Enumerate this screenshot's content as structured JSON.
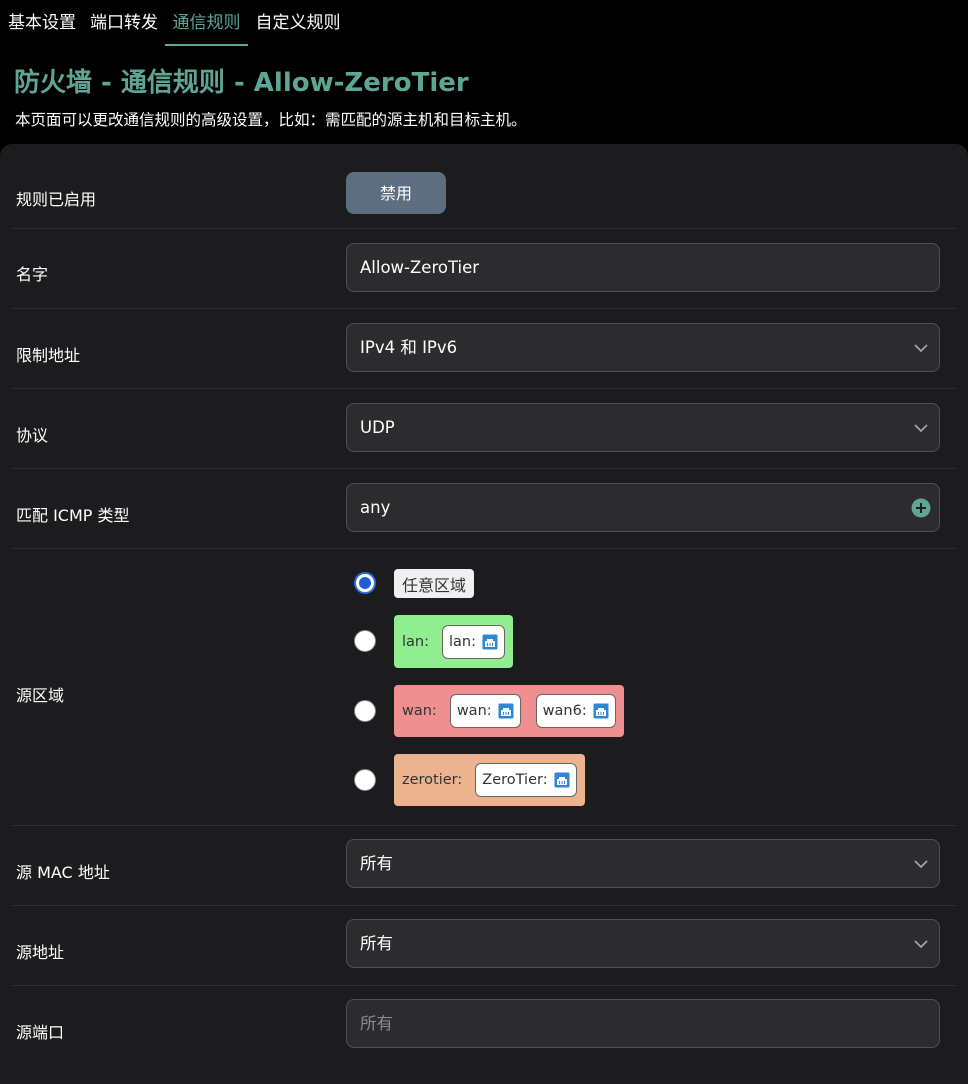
{
  "tabs": [
    {
      "label": "基本设置"
    },
    {
      "label": "端口转发"
    },
    {
      "label": "通信规则"
    },
    {
      "label": "自定义规则"
    }
  ],
  "active_tab": "通信规则",
  "page": {
    "title": "防火墙 - 通信规则 - Allow-ZeroTier",
    "description": "本页面可以更改通信规则的高级设置，比如：需匹配的源主机和目标主机。"
  },
  "form": {
    "enabled": {
      "label": "规则已启用",
      "button_label": "禁用"
    },
    "name": {
      "label": "名字",
      "value": "Allow-ZeroTier"
    },
    "family": {
      "label": "限制地址",
      "value": "IPv4 和 IPv6"
    },
    "protocol": {
      "label": "协议",
      "value": "UDP"
    },
    "icmp_type": {
      "label": "匹配 ICMP 类型",
      "value": "any"
    },
    "source_zone": {
      "label": "源区域",
      "options": [
        {
          "name": "任意区域",
          "checked": true,
          "color": "#f0f0f0",
          "networks": []
        },
        {
          "name": "lan:",
          "checked": false,
          "color": "#90ee90",
          "networks": [
            "lan:"
          ]
        },
        {
          "name": "wan:",
          "checked": false,
          "color": "#f08f8f",
          "networks": [
            "wan:",
            "wan6:"
          ]
        },
        {
          "name": "zerotier:",
          "checked": false,
          "color": "#ebb48f",
          "networks": [
            "ZeroTier:"
          ]
        }
      ]
    },
    "source_mac": {
      "label": "源 MAC 地址",
      "value": "所有"
    },
    "source_ip": {
      "label": "源地址",
      "value": "所有"
    },
    "source_port": {
      "label": "源端口",
      "placeholder": "所有"
    }
  },
  "colors": {
    "accent": "#5fa596",
    "panel_bg": "#1c1c1e",
    "field_bg": "#2c2c2e",
    "button_bg": "#5d6e80",
    "radio_selected": "#1d5fd2"
  },
  "icons": {
    "select_arrow": "chevron-down-icon",
    "add": "plus-circle-icon",
    "network": "ethernet-port-icon"
  }
}
